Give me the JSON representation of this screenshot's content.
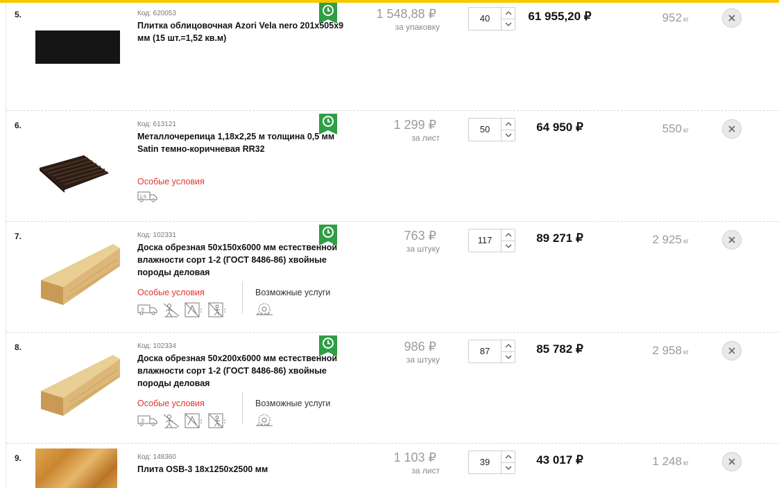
{
  "currency": "₽",
  "colors": {
    "accent_yellow": "#f6c800",
    "badge_green": "#2f9e44",
    "special_red": "#e0342f"
  },
  "items": [
    {
      "index": "5.",
      "code": "Код: 620053",
      "title": "Плитка облицовочная Azori Vela nero 201x505x9 мм (15 шт.=1,52 кв.м)",
      "price": "1 548,88 ₽",
      "unit": "за упаковку",
      "qty": "40",
      "total": "61 955,20 ₽",
      "weight": "952",
      "weight_unit": "кг",
      "special": "",
      "services": ""
    },
    {
      "index": "6.",
      "code": "Код: 613121",
      "title": "Металлочерепица 1,18x2,25 м толщина 0,5 мм Satin темно-коричневая RR32",
      "price": "1 299 ₽",
      "unit": "за лист",
      "qty": "50",
      "total": "64 950 ₽",
      "weight": "550",
      "weight_unit": "кг",
      "special": "Особые условия",
      "services": "",
      "truck_badge": "1.5"
    },
    {
      "index": "7.",
      "code": "Код: 102331",
      "title": "Доска обрезная 50x150x6000 мм естественной влажности сорт 1-2 (ГОСТ 8486-86) хвойные породы деловая",
      "price": "763 ₽",
      "unit": "за штуку",
      "qty": "117",
      "total": "89 271 ₽",
      "weight": "2 925",
      "weight_unit": "кг",
      "special": "Особые условия",
      "services": "Возможные услуги",
      "truck_badge": "5"
    },
    {
      "index": "8.",
      "code": "Код: 102334",
      "title": "Доска обрезная 50x200x6000 мм естественной влажности сорт 1-2 (ГОСТ 8486-86) хвойные породы деловая",
      "price": "986 ₽",
      "unit": "за штуку",
      "qty": "87",
      "total": "85 782 ₽",
      "weight": "2 958",
      "weight_unit": "кг",
      "special": "Особые условия",
      "services": "Возможные услуги",
      "truck_badge": "5"
    },
    {
      "index": "9.",
      "code": "Код: 148360",
      "title": "Плита OSB-3 18x1250x2500 мм",
      "price": "1 103 ₽",
      "unit": "за лист",
      "qty": "39",
      "total": "43 017 ₽",
      "weight": "1 248",
      "weight_unit": "кг",
      "special": "",
      "services": ""
    }
  ]
}
